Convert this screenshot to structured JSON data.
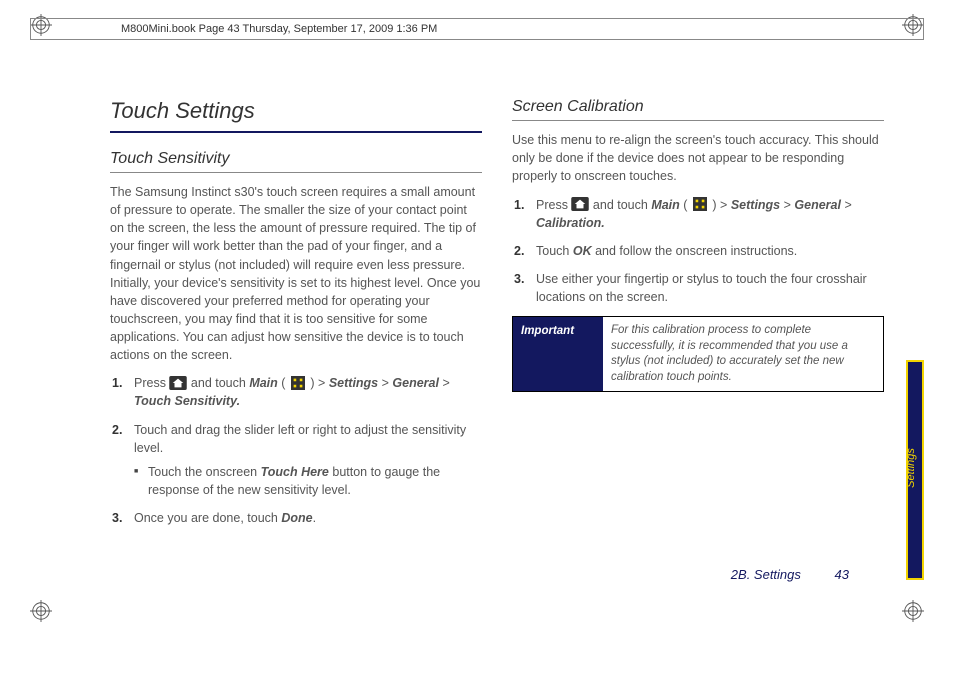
{
  "print_header": "M800Mini.book  Page 43  Thursday, September 17, 2009  1:36 PM",
  "left": {
    "title": "Touch Settings",
    "subtitle": "Touch Sensitivity",
    "intro": "The Samsung Instinct s30's touch screen requires a small amount of pressure to operate. The smaller the size of your contact point on the screen, the less the amount of pressure required. The tip of your finger will work better than the pad of your finger, and a fingernail or stylus (not included) will require even less pressure. Initially, your device's sensitivity is set to its highest level. Once you have discovered your preferred method for operating your touchscreen, you may find that it is too sensitive for some applications. You can adjust how sensitive the device is to touch actions on the screen.",
    "step1_a": "Press ",
    "step1_b": " and touch ",
    "step1_main": "Main",
    "step1_c": " ( ",
    "step1_d": " ) > ",
    "step1_settings": "Settings",
    "step1_gt": " > ",
    "step1_general": "General",
    "step1_gt2": " > ",
    "step1_touch": "Touch Sensitivity.",
    "step2": "Touch and drag the slider left or right to adjust the sensitivity level.",
    "step2_sub_a": "Touch the onscreen ",
    "step2_sub_b": "Touch Here",
    "step2_sub_c": " button to gauge the response of the new sensitivity level.",
    "step3_a": "Once you are done, touch ",
    "step3_b": "Done",
    "step3_c": "."
  },
  "right": {
    "subtitle": "Screen Calibration",
    "intro": "Use this menu to re-align the screen's touch accuracy. This should only be done if the device does not appear to be responding properly to onscreen touches.",
    "step1_a": "Press ",
    "step1_b": " and touch ",
    "step1_main": "Main",
    "step1_c": " ( ",
    "step1_d": " ) > ",
    "step1_settings": "Settings",
    "step1_gt": " > ",
    "step1_general": "General",
    "step1_gt2": " > ",
    "step1_cal": "Calibration.",
    "step2_a": "Touch ",
    "step2_b": "OK",
    "step2_c": " and follow the onscreen instructions.",
    "step3": "Use either your fingertip or stylus to touch the four crosshair locations on the screen.",
    "important_label": "Important",
    "important_body": "For this calibration process to complete successfully, it is recommended that you use a stylus (not included) to accurately set the new calibration touch points."
  },
  "side_tab": "Settings",
  "footer_section": "2B. Settings",
  "footer_page": "43"
}
